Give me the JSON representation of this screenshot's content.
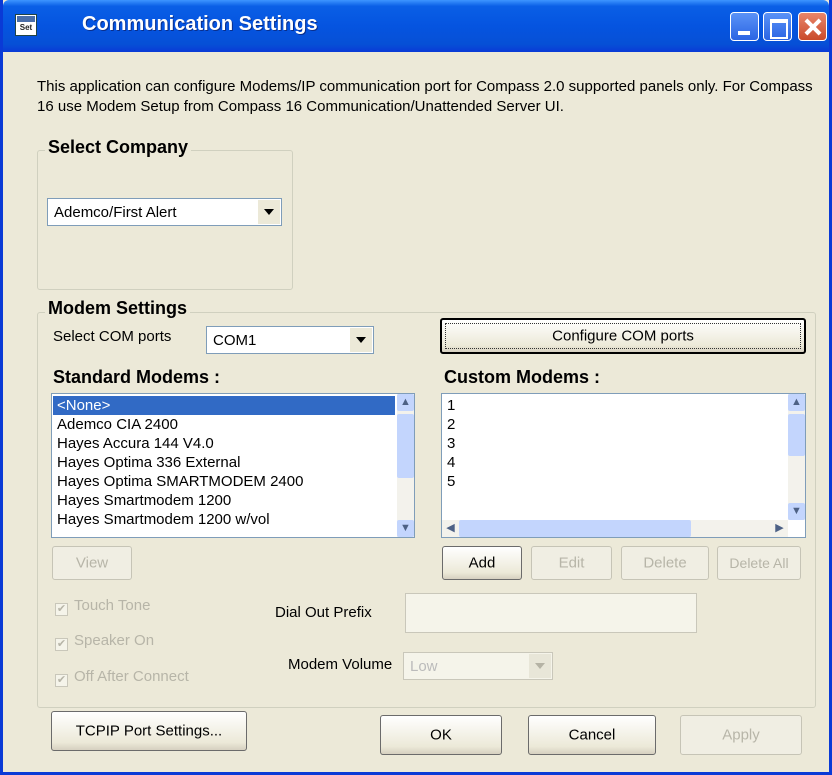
{
  "window": {
    "title": "Communication Settings"
  },
  "info_text": "This application can configure Modems/IP communication port for Compass 2.0 supported panels only. For Compass 16 use Modem Setup from Compass 16 Communication/Unattended Server UI.",
  "select_company": {
    "legend": "Select Company",
    "value": "Ademco/First Alert"
  },
  "modem_settings": {
    "legend": "Modem Settings",
    "com_label": "Select COM ports",
    "com_value": "COM1",
    "configure_button": "Configure COM ports",
    "standard_heading": "Standard Modems :",
    "custom_heading": "Custom Modems :",
    "standard_modems": [
      "<None>",
      "Ademco CIA  2400",
      "Hayes Accura 144 V4.0",
      "Hayes Optima 336  External",
      "Hayes Optima SMARTMODEM 2400",
      "Hayes Smartmodem  1200",
      "Hayes Smartmodem  1200 w/vol"
    ],
    "custom_modems": [
      "1",
      "2",
      "3",
      "4",
      "5"
    ],
    "view_button": "View",
    "add_button": "Add",
    "edit_button": "Edit",
    "delete_button": "Delete",
    "delete_all_button": "Delete All",
    "touch_tone": "Touch Tone",
    "speaker_on": "Speaker On",
    "off_after_connect": "Off After Connect",
    "dial_out_label": "Dial Out  Prefix",
    "dial_out_value": "",
    "modem_volume_label": "Modem Volume",
    "modem_volume_value": "Low"
  },
  "buttons": {
    "tcpip": "TCPIP Port Settings...",
    "ok": "OK",
    "cancel": "Cancel",
    "apply": "Apply"
  },
  "colors": {
    "titlebar": "#0554e0",
    "window_bg": "#ece9d8",
    "selection": "#316ac5"
  }
}
